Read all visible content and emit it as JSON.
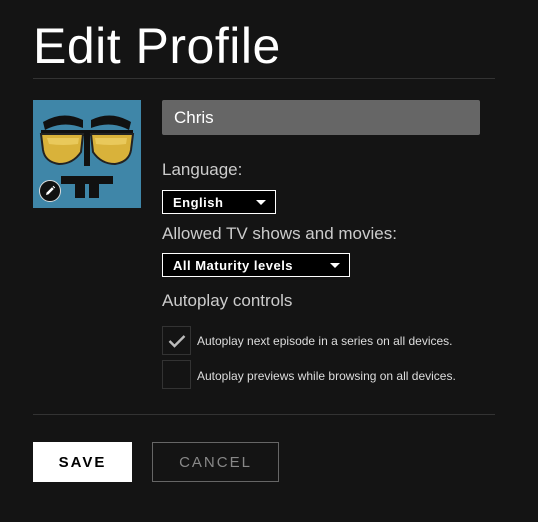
{
  "header": {
    "title": "Edit Profile"
  },
  "profile": {
    "name_value": "Chris",
    "avatar_bg_color": "#3f86a8"
  },
  "language": {
    "label": "Language:",
    "selected": "English"
  },
  "maturity": {
    "label": "Allowed TV shows and movies:",
    "selected": "All Maturity levels"
  },
  "autoplay": {
    "heading": "Autoplay controls",
    "options": [
      {
        "label": "Autoplay next episode in a series on all devices.",
        "checked": true
      },
      {
        "label": "Autoplay previews while browsing on all devices.",
        "checked": false
      }
    ]
  },
  "actions": {
    "save_label": "SAVE",
    "cancel_label": "CANCEL"
  }
}
